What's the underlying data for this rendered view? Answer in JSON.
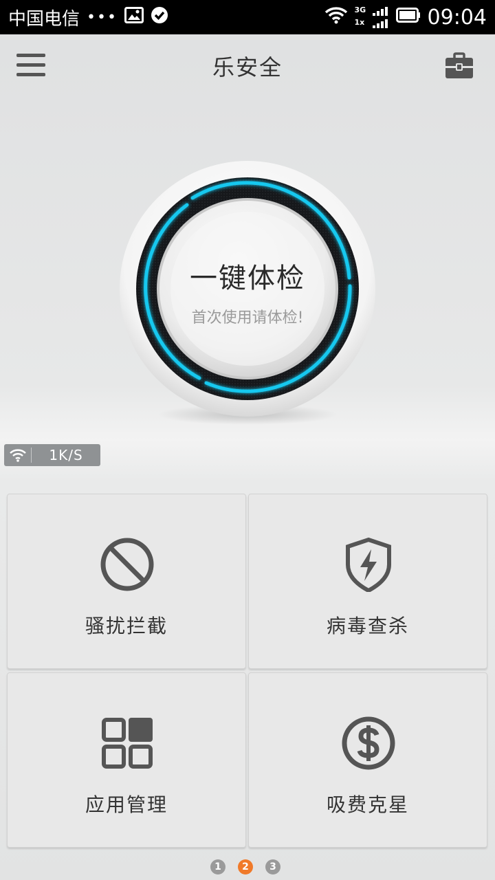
{
  "status_bar": {
    "carrier": "中国电信",
    "dots": "•••",
    "network": "3G",
    "network2": "1x",
    "time": "09:04"
  },
  "header": {
    "title": "乐安全",
    "menu_icon": "hamburger-icon",
    "right_icon": "toolbox-icon"
  },
  "dial": {
    "title": "一键体检",
    "subtitle": "首次使用请体检!",
    "ring_color": "#19c8ef"
  },
  "speed": {
    "icon": "wifi-icon",
    "value": "1K/S"
  },
  "tiles": [
    {
      "label": "骚扰拦截",
      "icon": "block-icon"
    },
    {
      "label": "病毒查杀",
      "icon": "shield-lightning-icon"
    },
    {
      "label": "应用管理",
      "icon": "app-grid-icon"
    },
    {
      "label": "吸费克星",
      "icon": "dollar-circle-icon"
    }
  ],
  "pager": {
    "pages": [
      "1",
      "2",
      "3"
    ],
    "active_page": "2",
    "active_color": "#f07a2a"
  }
}
